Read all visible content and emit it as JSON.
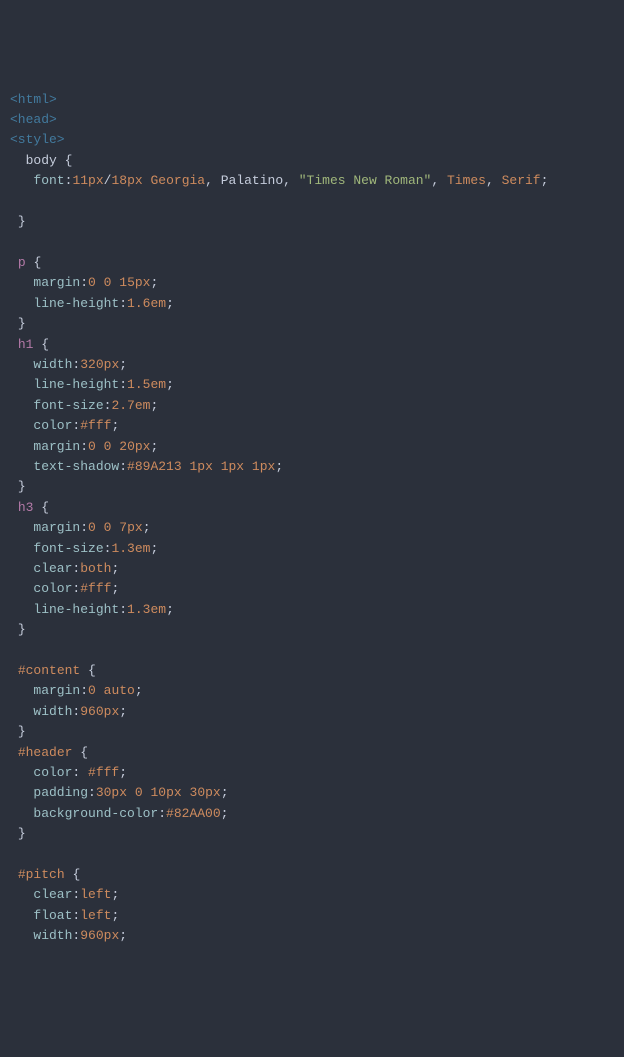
{
  "lines": [
    [
      {
        "c": "tag",
        "t": "<html>"
      }
    ],
    [
      {
        "c": "tag",
        "t": "<head>"
      }
    ],
    [
      {
        "c": "tag",
        "t": "<style>"
      }
    ],
    [
      {
        "c": "",
        "t": "  body "
      },
      {
        "c": "brace",
        "t": "{"
      }
    ],
    [
      {
        "c": "",
        "t": "   "
      },
      {
        "c": "prop",
        "t": "font"
      },
      {
        "c": "",
        "t": ":"
      },
      {
        "c": "num",
        "t": "11px"
      },
      {
        "c": "",
        "t": "/"
      },
      {
        "c": "num",
        "t": "18px"
      },
      {
        "c": "",
        "t": " "
      },
      {
        "c": "id",
        "t": "Georgia"
      },
      {
        "c": "",
        "t": ", Palatino, "
      },
      {
        "c": "str",
        "t": "\"Times New Roman\""
      },
      {
        "c": "",
        "t": ", "
      },
      {
        "c": "id",
        "t": "Times"
      },
      {
        "c": "",
        "t": ", "
      },
      {
        "c": "id",
        "t": "Serif"
      },
      {
        "c": "",
        "t": ";"
      }
    ],
    [
      {
        "c": "",
        "t": ""
      }
    ],
    [
      {
        "c": "",
        "t": " "
      },
      {
        "c": "brace",
        "t": "}"
      }
    ],
    [
      {
        "c": "",
        "t": ""
      }
    ],
    [
      {
        "c": "",
        "t": " "
      },
      {
        "c": "sel",
        "t": "p"
      },
      {
        "c": "",
        "t": " "
      },
      {
        "c": "brace",
        "t": "{"
      }
    ],
    [
      {
        "c": "",
        "t": "   "
      },
      {
        "c": "prop",
        "t": "margin"
      },
      {
        "c": "",
        "t": ":"
      },
      {
        "c": "num",
        "t": "0"
      },
      {
        "c": "",
        "t": " "
      },
      {
        "c": "num",
        "t": "0"
      },
      {
        "c": "",
        "t": " "
      },
      {
        "c": "num",
        "t": "15px"
      },
      {
        "c": "",
        "t": ";"
      }
    ],
    [
      {
        "c": "",
        "t": "   "
      },
      {
        "c": "prop",
        "t": "line-height"
      },
      {
        "c": "",
        "t": ":"
      },
      {
        "c": "num",
        "t": "1.6em"
      },
      {
        "c": "",
        "t": ";"
      }
    ],
    [
      {
        "c": "",
        "t": " "
      },
      {
        "c": "brace",
        "t": "}"
      }
    ],
    [
      {
        "c": "",
        "t": " "
      },
      {
        "c": "sel",
        "t": "h1"
      },
      {
        "c": "",
        "t": " "
      },
      {
        "c": "brace",
        "t": "{"
      }
    ],
    [
      {
        "c": "",
        "t": "   "
      },
      {
        "c": "prop",
        "t": "width"
      },
      {
        "c": "",
        "t": ":"
      },
      {
        "c": "num",
        "t": "320px"
      },
      {
        "c": "",
        "t": ";"
      }
    ],
    [
      {
        "c": "",
        "t": "   "
      },
      {
        "c": "prop",
        "t": "line-height"
      },
      {
        "c": "",
        "t": ":"
      },
      {
        "c": "num",
        "t": "1.5em"
      },
      {
        "c": "",
        "t": ";"
      }
    ],
    [
      {
        "c": "",
        "t": "   "
      },
      {
        "c": "prop",
        "t": "font-size"
      },
      {
        "c": "",
        "t": ":"
      },
      {
        "c": "num",
        "t": "2.7em"
      },
      {
        "c": "",
        "t": ";"
      }
    ],
    [
      {
        "c": "",
        "t": "   "
      },
      {
        "c": "prop",
        "t": "color"
      },
      {
        "c": "",
        "t": ":"
      },
      {
        "c": "id",
        "t": "#fff"
      },
      {
        "c": "",
        "t": ";"
      }
    ],
    [
      {
        "c": "",
        "t": "   "
      },
      {
        "c": "prop",
        "t": "margin"
      },
      {
        "c": "",
        "t": ":"
      },
      {
        "c": "num",
        "t": "0"
      },
      {
        "c": "",
        "t": " "
      },
      {
        "c": "num",
        "t": "0"
      },
      {
        "c": "",
        "t": " "
      },
      {
        "c": "num",
        "t": "20px"
      },
      {
        "c": "",
        "t": ";"
      }
    ],
    [
      {
        "c": "",
        "t": "   "
      },
      {
        "c": "prop",
        "t": "text-shadow"
      },
      {
        "c": "",
        "t": ":"
      },
      {
        "c": "id",
        "t": "#89A213"
      },
      {
        "c": "",
        "t": " "
      },
      {
        "c": "num",
        "t": "1px"
      },
      {
        "c": "",
        "t": " "
      },
      {
        "c": "num",
        "t": "1px"
      },
      {
        "c": "",
        "t": " "
      },
      {
        "c": "num",
        "t": "1px"
      },
      {
        "c": "",
        "t": ";"
      }
    ],
    [
      {
        "c": "",
        "t": " "
      },
      {
        "c": "brace",
        "t": "}"
      }
    ],
    [
      {
        "c": "",
        "t": " "
      },
      {
        "c": "sel",
        "t": "h3"
      },
      {
        "c": "",
        "t": " "
      },
      {
        "c": "brace",
        "t": "{"
      }
    ],
    [
      {
        "c": "",
        "t": "   "
      },
      {
        "c": "prop",
        "t": "margin"
      },
      {
        "c": "",
        "t": ":"
      },
      {
        "c": "num",
        "t": "0"
      },
      {
        "c": "",
        "t": " "
      },
      {
        "c": "num",
        "t": "0"
      },
      {
        "c": "",
        "t": " "
      },
      {
        "c": "num",
        "t": "7px"
      },
      {
        "c": "",
        "t": ";"
      }
    ],
    [
      {
        "c": "",
        "t": "   "
      },
      {
        "c": "prop",
        "t": "font-size"
      },
      {
        "c": "",
        "t": ":"
      },
      {
        "c": "num",
        "t": "1.3em"
      },
      {
        "c": "",
        "t": ";"
      }
    ],
    [
      {
        "c": "",
        "t": "   "
      },
      {
        "c": "prop",
        "t": "clear"
      },
      {
        "c": "",
        "t": ":"
      },
      {
        "c": "id",
        "t": "both"
      },
      {
        "c": "",
        "t": ";"
      }
    ],
    [
      {
        "c": "",
        "t": "   "
      },
      {
        "c": "prop",
        "t": "color"
      },
      {
        "c": "",
        "t": ":"
      },
      {
        "c": "id",
        "t": "#fff"
      },
      {
        "c": "",
        "t": ";"
      }
    ],
    [
      {
        "c": "",
        "t": "   "
      },
      {
        "c": "prop",
        "t": "line-height"
      },
      {
        "c": "",
        "t": ":"
      },
      {
        "c": "num",
        "t": "1.3em"
      },
      {
        "c": "",
        "t": ";"
      }
    ],
    [
      {
        "c": "",
        "t": " "
      },
      {
        "c": "brace",
        "t": "}"
      }
    ],
    [
      {
        "c": "",
        "t": ""
      }
    ],
    [
      {
        "c": "",
        "t": " "
      },
      {
        "c": "id",
        "t": "#content"
      },
      {
        "c": "",
        "t": " "
      },
      {
        "c": "brace",
        "t": "{"
      }
    ],
    [
      {
        "c": "",
        "t": "   "
      },
      {
        "c": "prop",
        "t": "margin"
      },
      {
        "c": "",
        "t": ":"
      },
      {
        "c": "num",
        "t": "0"
      },
      {
        "c": "",
        "t": " "
      },
      {
        "c": "id",
        "t": "auto"
      },
      {
        "c": "",
        "t": ";"
      }
    ],
    [
      {
        "c": "",
        "t": "   "
      },
      {
        "c": "prop",
        "t": "width"
      },
      {
        "c": "",
        "t": ":"
      },
      {
        "c": "num",
        "t": "960px"
      },
      {
        "c": "",
        "t": ";"
      }
    ],
    [
      {
        "c": "",
        "t": " "
      },
      {
        "c": "brace",
        "t": "}"
      }
    ],
    [
      {
        "c": "",
        "t": " "
      },
      {
        "c": "id",
        "t": "#header"
      },
      {
        "c": "",
        "t": " "
      },
      {
        "c": "brace",
        "t": "{"
      }
    ],
    [
      {
        "c": "",
        "t": "   "
      },
      {
        "c": "prop",
        "t": "color"
      },
      {
        "c": "",
        "t": ": "
      },
      {
        "c": "id",
        "t": "#fff"
      },
      {
        "c": "",
        "t": ";"
      }
    ],
    [
      {
        "c": "",
        "t": "   "
      },
      {
        "c": "prop",
        "t": "padding"
      },
      {
        "c": "",
        "t": ":"
      },
      {
        "c": "num",
        "t": "30px"
      },
      {
        "c": "",
        "t": " "
      },
      {
        "c": "num",
        "t": "0"
      },
      {
        "c": "",
        "t": " "
      },
      {
        "c": "num",
        "t": "10px"
      },
      {
        "c": "",
        "t": " "
      },
      {
        "c": "num",
        "t": "30px"
      },
      {
        "c": "",
        "t": ";"
      }
    ],
    [
      {
        "c": "",
        "t": "   "
      },
      {
        "c": "prop",
        "t": "background-color"
      },
      {
        "c": "",
        "t": ":"
      },
      {
        "c": "id",
        "t": "#82AA00"
      },
      {
        "c": "",
        "t": ";"
      }
    ],
    [
      {
        "c": "",
        "t": " "
      },
      {
        "c": "brace",
        "t": "}"
      }
    ],
    [
      {
        "c": "",
        "t": ""
      }
    ],
    [
      {
        "c": "",
        "t": " "
      },
      {
        "c": "id",
        "t": "#pitch"
      },
      {
        "c": "",
        "t": " "
      },
      {
        "c": "brace",
        "t": "{"
      }
    ],
    [
      {
        "c": "",
        "t": "   "
      },
      {
        "c": "prop",
        "t": "clear"
      },
      {
        "c": "",
        "t": ":"
      },
      {
        "c": "id",
        "t": "left"
      },
      {
        "c": "",
        "t": ";"
      }
    ],
    [
      {
        "c": "",
        "t": "   "
      },
      {
        "c": "prop",
        "t": "float"
      },
      {
        "c": "",
        "t": ":"
      },
      {
        "c": "id",
        "t": "left"
      },
      {
        "c": "",
        "t": ";"
      }
    ],
    [
      {
        "c": "",
        "t": "   "
      },
      {
        "c": "prop",
        "t": "width"
      },
      {
        "c": "",
        "t": ":"
      },
      {
        "c": "num",
        "t": "960px"
      },
      {
        "c": "",
        "t": ";"
      }
    ]
  ]
}
